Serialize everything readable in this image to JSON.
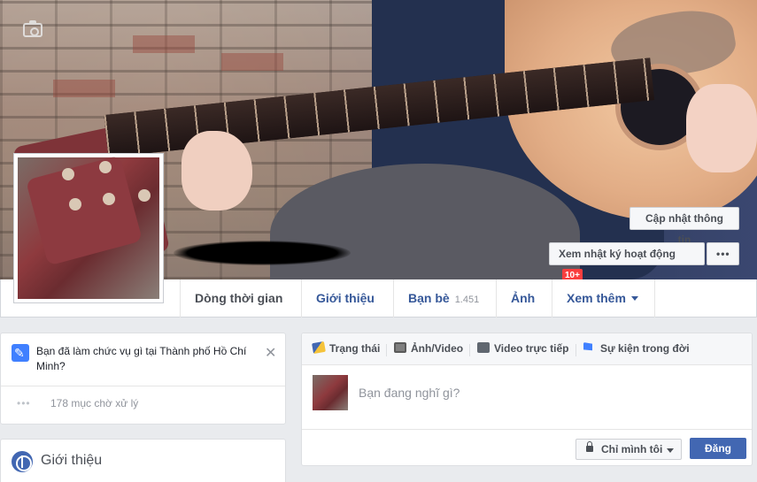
{
  "cover": {
    "update_info_label": "Cập nhật thông tin",
    "activity_log_label": "Xem nhật ký hoạt động",
    "activity_badge": "10+",
    "more_label": "•••"
  },
  "nav": {
    "tabs": [
      {
        "label": "Dòng thời gian"
      },
      {
        "label": "Giới thiệu"
      },
      {
        "label": "Bạn bè",
        "count": "1.451"
      },
      {
        "label": "Ảnh"
      },
      {
        "label": "Xem thêm"
      }
    ]
  },
  "question_card": {
    "text": "Bạn đã làm chức vụ gì tại Thành phố Hồ Chí Minh?",
    "close": "✕",
    "pending_dots": "•••",
    "pending_text": "178 mục chờ xử lý"
  },
  "about_card": {
    "title": "Giới thiệu"
  },
  "composer": {
    "tabs": [
      {
        "label": "Trạng thái",
        "icon": "pencil-icon"
      },
      {
        "label": "Ảnh/Video",
        "icon": "photo-icon"
      },
      {
        "label": "Video trực tiếp",
        "icon": "video-camera-icon"
      },
      {
        "label": "Sự kiện trong đời",
        "icon": "flag-icon"
      }
    ],
    "placeholder": "Bạn đang nghĩ gì?",
    "privacy_label": "Chỉ mình tôi",
    "post_label": "Đăng"
  },
  "colors": {
    "brand_blue": "#4267b2",
    "link_blue": "#365899",
    "badge_red": "#fa3e3e",
    "page_bg": "#e9ebee"
  }
}
